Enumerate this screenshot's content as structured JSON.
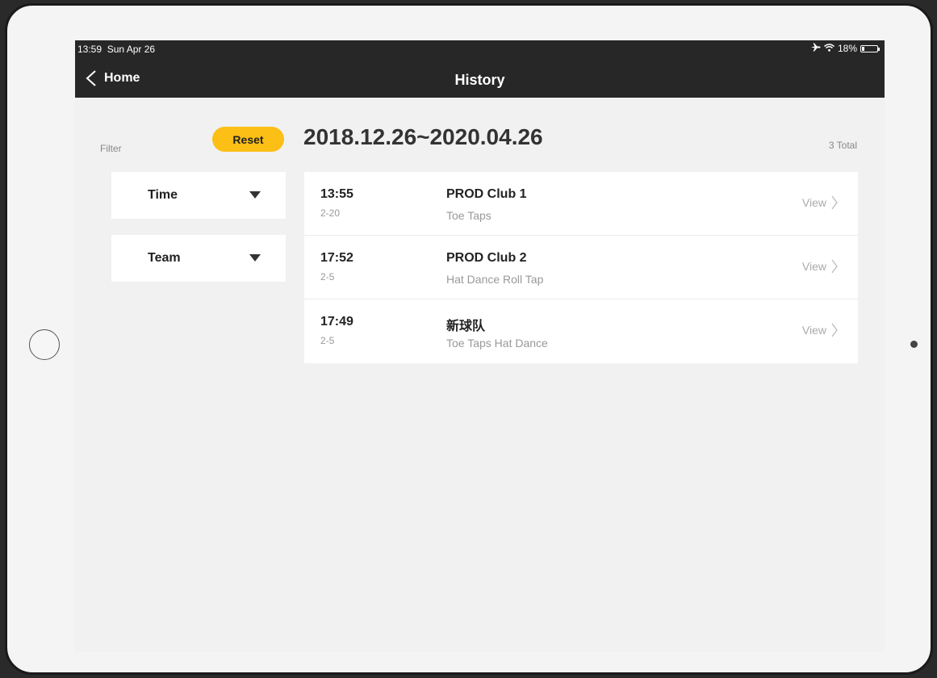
{
  "status_bar": {
    "time": "13:59",
    "date": "Sun Apr 26",
    "battery": "18%",
    "battery_level": 0.18,
    "icons": [
      "airplane-icon",
      "wifi-icon",
      "battery-icon"
    ]
  },
  "nav": {
    "back_label": "Home",
    "title": "History"
  },
  "filter": {
    "label": "Filter",
    "reset_label": "Reset",
    "dropdowns": [
      {
        "label": "Time"
      },
      {
        "label": "Team"
      }
    ]
  },
  "history": {
    "range": "2018.12.26~2020.04.26",
    "total": "3 Total",
    "view_label": "View",
    "items": [
      {
        "time": "13:55",
        "date": "2-20",
        "team": "PROD Club 1",
        "moves": "Toe Taps"
      },
      {
        "time": "17:52",
        "date": "2-5",
        "team": "PROD Club 2",
        "moves": "Hat Dance Roll Tap"
      },
      {
        "time": "17:49",
        "date": "2-5",
        "team": "新球队",
        "moves": "Toe Taps Hat Dance"
      }
    ]
  },
  "colors": {
    "accent": "#fbbf16",
    "nav_bar": "#272727",
    "background": "#f1f1f1"
  }
}
